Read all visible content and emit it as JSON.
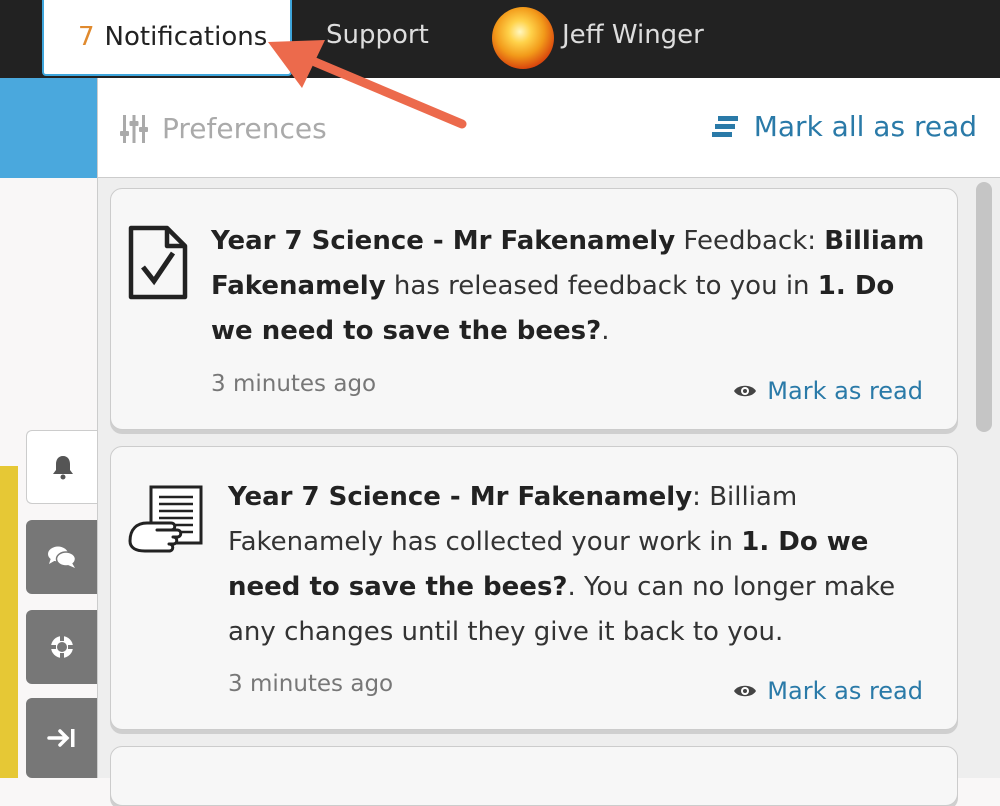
{
  "topbar": {
    "notifications_count": "7",
    "notifications_label": "Notifications",
    "support_label": "Support",
    "user_name": "Jeff Winger"
  },
  "panel": {
    "preferences_label": "Preferences",
    "mark_all_label": "Mark all as read"
  },
  "notifications": [
    {
      "course": "Year 7 Science - Mr Fakenamely",
      "text1": " Feedback: ",
      "person": "Billiam Fakenamely",
      "text2": " has released feedback to you in ",
      "task": "1. Do we need to save the bees?",
      "text3": ".",
      "time": "3 minutes ago",
      "action": "Mark as read",
      "icon": "document-check-icon"
    },
    {
      "course": "Year 7 Science - Mr Fakenamely",
      "text1": ": Billiam Fakenamely has collected your work in ",
      "task": "1. Do we need to save the bees?",
      "text2": ". You can no longer make any changes until they give it back to you.",
      "time": "3 minutes ago",
      "action": "Mark as read",
      "icon": "hand-document-icon"
    }
  ],
  "colors": {
    "accent": "#2a7aa8",
    "count": "#e08a2e",
    "arrow": "#ec6a4c",
    "tab_border": "#3fa6dc"
  }
}
